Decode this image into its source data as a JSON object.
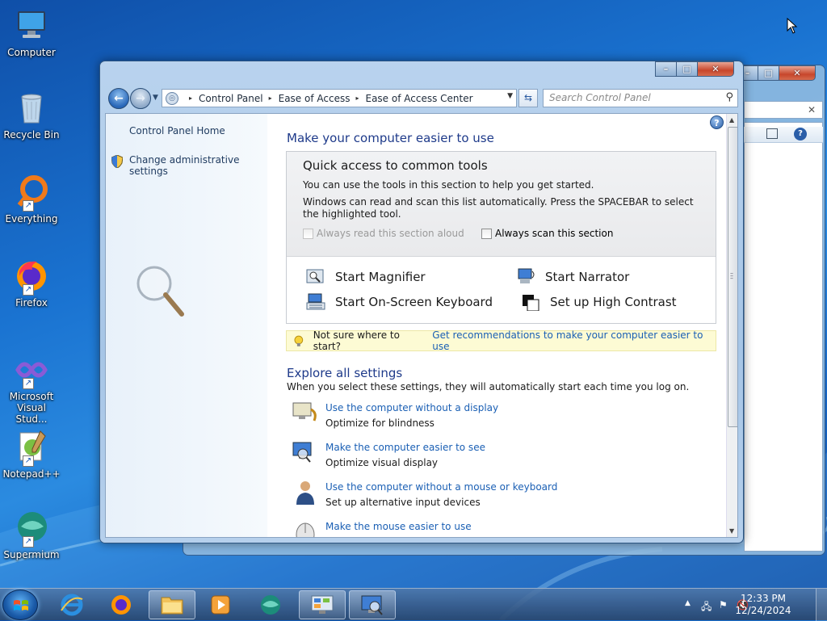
{
  "desktop": {
    "icons": [
      {
        "label": "Computer"
      },
      {
        "label": "Recycle Bin"
      },
      {
        "label": "Everything"
      },
      {
        "label": "Firefox"
      },
      {
        "label": "Microsoft Visual Stud..."
      },
      {
        "label": "Notepad++"
      },
      {
        "label": "Supermium"
      }
    ]
  },
  "window": {
    "caption_buttons": {
      "minimize": "–",
      "maximize": "□",
      "close": "✕"
    },
    "address": {
      "crumbs": [
        "Control Panel",
        "Ease of Access",
        "Ease of Access Center"
      ]
    },
    "search_placeholder": "Search Control Panel",
    "left_nav": {
      "home": "Control Panel Home",
      "admin": "Change administrative settings"
    },
    "heading": "Make your computer easier to use",
    "quick_access": {
      "title": "Quick access to common tools",
      "line1": "You can use the tools in this section to help you get started.",
      "line2": "Windows can read and scan this list automatically.  Press the SPACEBAR to select the highlighted tool.",
      "read_aloud": "Always read this section aloud",
      "scan": "Always scan this section",
      "tools": {
        "magnifier": "Start Magnifier",
        "narrator": "Start Narrator",
        "keyboard": "Start On-Screen Keyboard",
        "contrast": "Set up High Contrast"
      }
    },
    "tip": {
      "text": "Not sure where to start?",
      "link": "Get recommendations to make your computer easier to use"
    },
    "explore": {
      "title": "Explore all settings",
      "subtitle": "When you select these settings, they will automatically start each time you log on.",
      "items": [
        {
          "title": "Use the computer without a display",
          "sub": "Optimize for blindness"
        },
        {
          "title": "Make the computer easier to see",
          "sub": "Optimize visual display"
        },
        {
          "title": "Use the computer without a mouse or keyboard",
          "sub": "Set up alternative input devices"
        },
        {
          "title": "Make the mouse easier to use",
          "sub": ""
        }
      ]
    }
  },
  "taskbar": {
    "clock_time": "12:33 PM",
    "clock_date": "12/24/2024"
  },
  "colors": {
    "link": "#1a5fb4",
    "heading": "#1e3a8a",
    "tip_bg": "#fdfbd4"
  }
}
